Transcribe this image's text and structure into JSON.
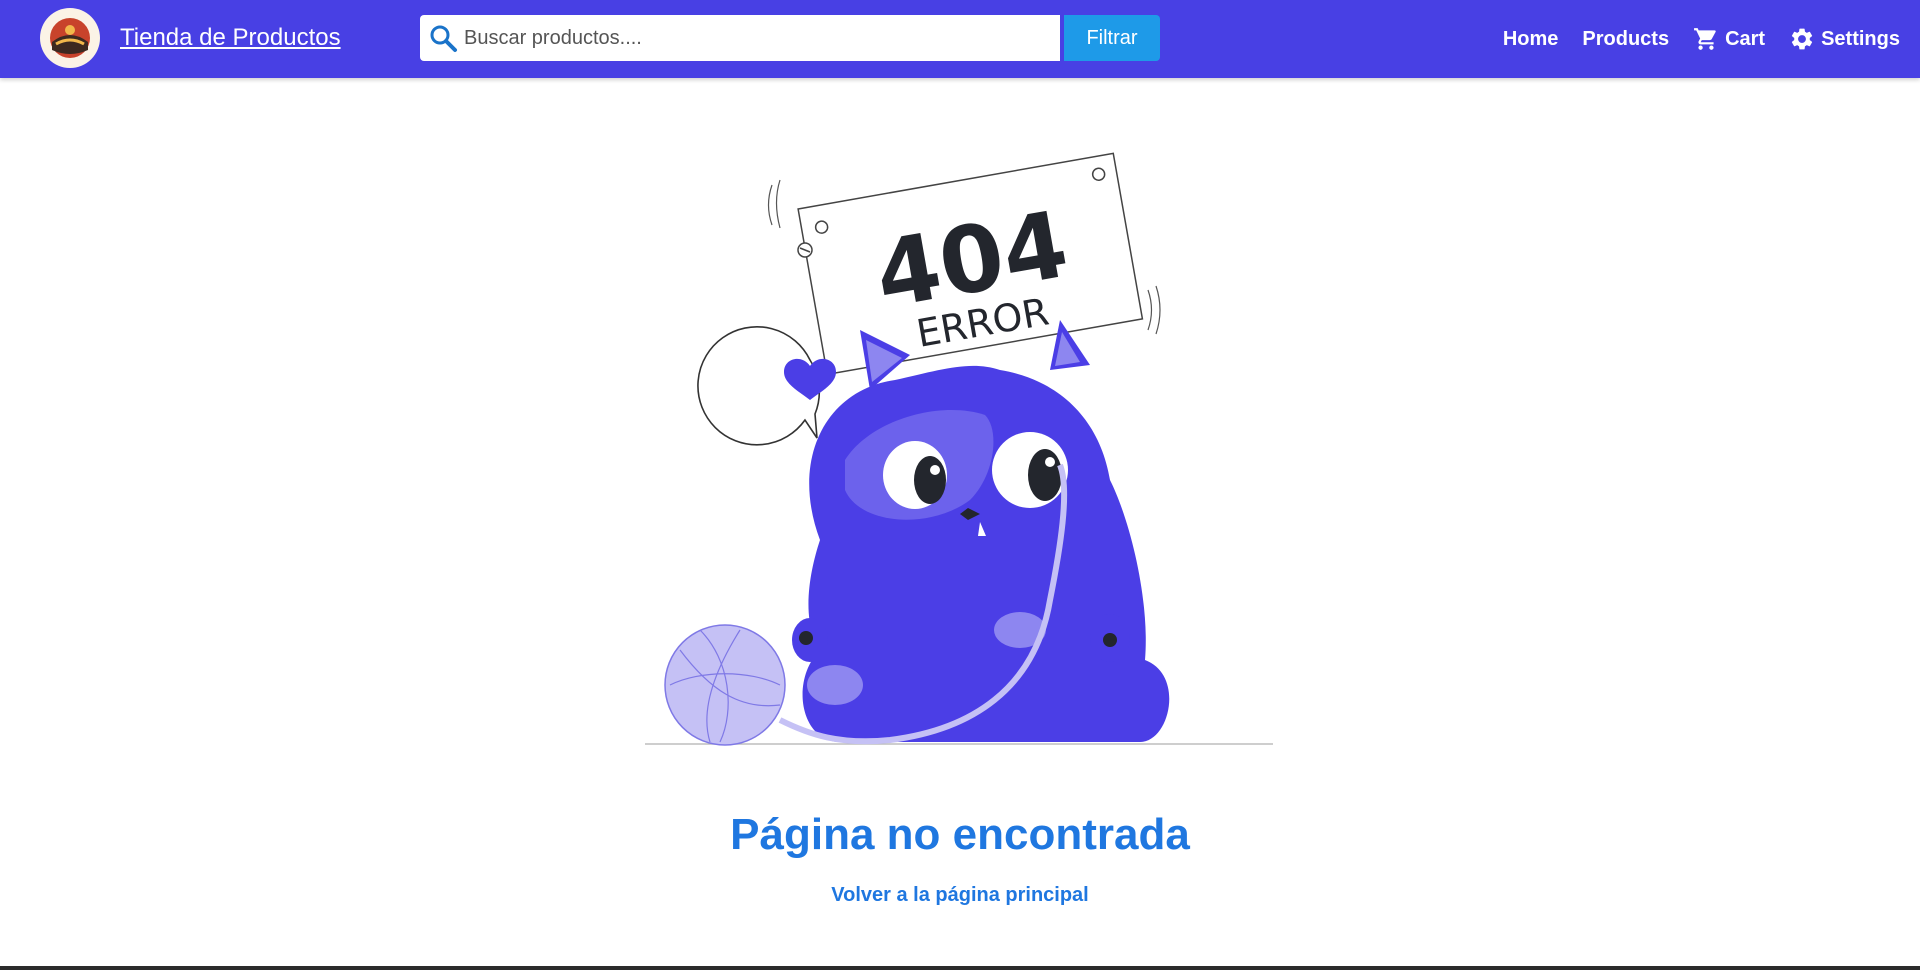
{
  "header": {
    "brand": "Tienda de Productos",
    "logo_icon": "store-logo-icon",
    "search": {
      "placeholder": "Buscar productos....",
      "value": ""
    },
    "filter_label": "Filtrar",
    "nav": [
      {
        "label": "Home",
        "icon": null
      },
      {
        "label": "Products",
        "icon": null
      },
      {
        "label": "Cart",
        "icon": "cart-icon"
      },
      {
        "label": "Settings",
        "icon": "gear-icon"
      }
    ]
  },
  "illustration": {
    "sign_number": "404",
    "sign_word": "ERROR"
  },
  "main": {
    "title": "Página no encontrada",
    "back_link": "Volver a la página principal"
  },
  "colors": {
    "navbar": "#4840e4",
    "filter_button": "#1e9ae8",
    "accent_text": "#1f77e0",
    "cat": "#4b3ee6",
    "yarn": "#c5c1f5"
  }
}
